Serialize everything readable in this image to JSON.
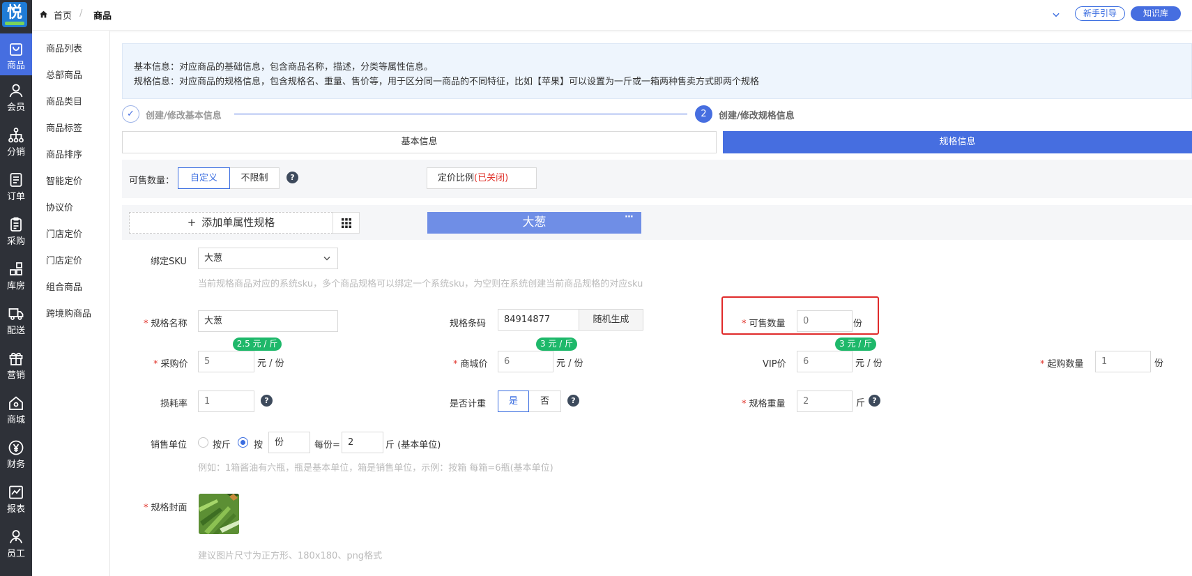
{
  "colors": {
    "accent": "#466ee0",
    "rail": "#2e3138",
    "required": "#e0322a",
    "badge": "#1eb86a",
    "highlight_border": "#e02a2a"
  },
  "rail": {
    "logo_text": "悦",
    "items": [
      {
        "label": "商品",
        "icon": "bag-icon"
      },
      {
        "label": "会员",
        "icon": "user-icon"
      },
      {
        "label": "分销",
        "icon": "tree-icon"
      },
      {
        "label": "订单",
        "icon": "list-doc-icon"
      },
      {
        "label": "采购",
        "icon": "clipboard-icon"
      },
      {
        "label": "库房",
        "icon": "warehouse-grid-icon"
      },
      {
        "label": "配送",
        "icon": "truck-icon"
      },
      {
        "label": "营销",
        "icon": "gift-icon"
      },
      {
        "label": "商城",
        "icon": "home-store-icon"
      },
      {
        "label": "财务",
        "icon": "yuan-icon"
      },
      {
        "label": "报表",
        "icon": "chart-icon"
      },
      {
        "label": "员工",
        "icon": "staff-icon"
      }
    ]
  },
  "submenu": [
    "商品列表",
    "总部商品",
    "商品类目",
    "商品标签",
    "商品排序",
    "智能定价",
    "协议价",
    "门店定价",
    "门店定价",
    "组合商品",
    "跨境购商品"
  ],
  "topbar": {
    "home": "首页",
    "sep": "/",
    "current": "商品",
    "guide_button": "新手引导",
    "kb_button": "知识库"
  },
  "info": {
    "line1": "基本信息：对应商品的基础信息，包含商品名称，描述，分类等属性信息。",
    "line2": "规格信息：对应商品的规格信息，包含规格名、重量、售价等，用于区分同一商品的不同特征，比如【苹果】可以设置为一斤或一箱两种售卖方式即两个规格"
  },
  "steps": [
    {
      "label": "创建/修改基本信息",
      "mark": "✓"
    },
    {
      "label": "创建/修改规格信息",
      "mark": "2"
    }
  ],
  "tabs": {
    "basic": "基本信息",
    "spec": "规格信息"
  },
  "sale_qty": {
    "label": "可售数量：",
    "custom": "自定义",
    "unlimited": "不限制",
    "q": "?",
    "pricing_ratio": "定价比例",
    "pricing_status": "(已关闭)"
  },
  "spec_bar": {
    "add": "添加单属性规格",
    "plus": "+",
    "spec_chip": "大葱",
    "more": "···"
  },
  "form": {
    "bind_sku": {
      "label": "绑定SKU",
      "value": "大葱",
      "hint": "当前规格商品对应的系统sku，多个商品规格可以绑定一个系统sku，为空则在系统创建当前商品规格的对应sku"
    },
    "spec_name": {
      "label": "规格名称",
      "value": "大葱"
    },
    "barcode": {
      "label": "规格条码",
      "value": "84914877",
      "button": "随机生成"
    },
    "sellable": {
      "label": "可售数量",
      "value": "0",
      "unit": "份"
    },
    "purchase": {
      "label": "采购价",
      "value": "5",
      "unit": "元 / 份",
      "badge": "2.5 元 / 斤"
    },
    "mall": {
      "label": "商城价",
      "value": "6",
      "unit": "元 / 份",
      "badge": "3 元 / 斤"
    },
    "vip": {
      "label": "VIP价",
      "value": "6",
      "unit": "元 / 份",
      "badge": "3 元 / 斤"
    },
    "min_qty": {
      "label": "起购数量",
      "value": "1",
      "unit": "份"
    },
    "loss": {
      "label": "损耗率",
      "value": "1"
    },
    "weighed": {
      "label": "是否计重",
      "yes": "是",
      "no": "否"
    },
    "weight": {
      "label": "规格重量",
      "value": "2",
      "unit": "斤"
    },
    "sale_unit": {
      "label": "销售单位",
      "by_jin": "按斤",
      "by": "按",
      "unit_value": "份",
      "per": "每份=",
      "per_value": "2",
      "base": "斤 (基本单位)",
      "hint": "例如：1箱酱油有六瓶，瓶是基本单位，箱是销售单位，示例：按箱 每箱=6瓶(基本单位)"
    },
    "cover": {
      "label": "规格封面",
      "hint": "建议图片尺寸为正方形、180x180、png格式"
    }
  }
}
